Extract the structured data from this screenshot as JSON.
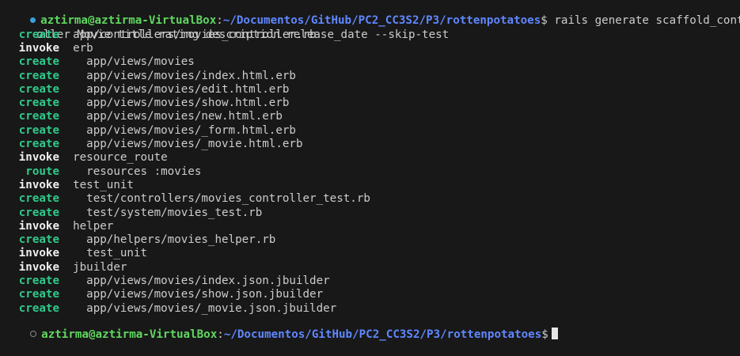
{
  "prompt": {
    "user_host": "aztirma@aztirma-VirtualBox",
    "separator": ":",
    "path": "~/Documentos/GitHub/PC2_CC3S2/P3/rottenpotatoes",
    "symbol": "$"
  },
  "command": {
    "first_part": " rails generate scaffold_contr",
    "continuation": "oller Movie title rating description release_date --skip-test"
  },
  "output": [
    {
      "action": "create",
      "arg": "app/controllers/movies_controller.rb"
    },
    {
      "action": "invoke",
      "arg": "erb"
    },
    {
      "action": "create",
      "arg": "  app/views/movies"
    },
    {
      "action": "create",
      "arg": "  app/views/movies/index.html.erb"
    },
    {
      "action": "create",
      "arg": "  app/views/movies/edit.html.erb"
    },
    {
      "action": "create",
      "arg": "  app/views/movies/show.html.erb"
    },
    {
      "action": "create",
      "arg": "  app/views/movies/new.html.erb"
    },
    {
      "action": "create",
      "arg": "  app/views/movies/_form.html.erb"
    },
    {
      "action": "create",
      "arg": "  app/views/movies/_movie.html.erb"
    },
    {
      "action": "invoke",
      "arg": "resource_route"
    },
    {
      "action": "route",
      "arg": "  resources :movies"
    },
    {
      "action": "invoke",
      "arg": "test_unit"
    },
    {
      "action": "create",
      "arg": "  test/controllers/movies_controller_test.rb"
    },
    {
      "action": "create",
      "arg": "  test/system/movies_test.rb"
    },
    {
      "action": "invoke",
      "arg": "helper"
    },
    {
      "action": "create",
      "arg": "  app/helpers/movies_helper.rb"
    },
    {
      "action": "invoke",
      "arg": "  test_unit"
    },
    {
      "action": "invoke",
      "arg": "jbuilder"
    },
    {
      "action": "create",
      "arg": "  app/views/movies/index.json.jbuilder"
    },
    {
      "action": "create",
      "arg": "  app/views/movies/show.json.jbuilder"
    },
    {
      "action": "create",
      "arg": "  app/views/movies/_movie.json.jbuilder"
    }
  ],
  "colors": {
    "background": "#181818",
    "user_host": "#5fd75f",
    "path": "#5f87ff",
    "create": "#2fc98a",
    "invoke": "#f0f0f0",
    "status_dot_done": "#3aa0dc"
  },
  "icons": {
    "first_prompt_marker": "status-dot-icon",
    "last_prompt_marker": "status-dot-empty-icon",
    "cursor": "block-cursor-icon"
  }
}
